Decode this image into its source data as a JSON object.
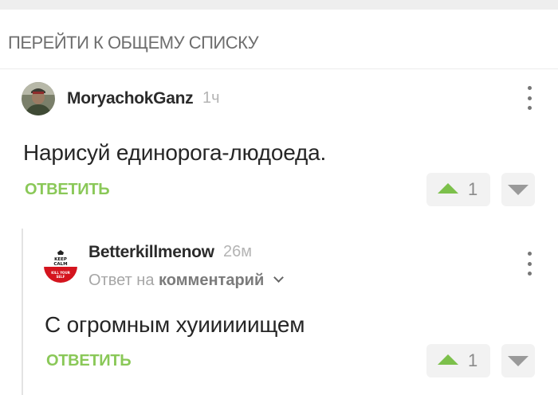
{
  "header": {
    "back_label": "ПЕРЕЙТИ К ОБЩЕМУ СПИСКУ"
  },
  "comments": [
    {
      "username": "MoryachokGanz",
      "time": "1ч",
      "text": "Нарисуй единорога-людоеда.",
      "reply_label": "ОТВЕТИТЬ",
      "rating": "1"
    },
    {
      "username": "Betterkillmenow",
      "time": "26м",
      "reply_to_prefix": "Ответ на",
      "reply_to_target": "комментарий",
      "text": "С огромным хуииииищем",
      "reply_label": "ОТВЕТИТЬ",
      "rating": "1",
      "avatar_text": [
        "KEEP",
        "CALM",
        "KILL YOUR",
        "SELF"
      ]
    }
  ],
  "colors": {
    "accent_green": "#8ac858",
    "upvote_green": "#7cc04b",
    "muted": "#b4b4b4"
  }
}
